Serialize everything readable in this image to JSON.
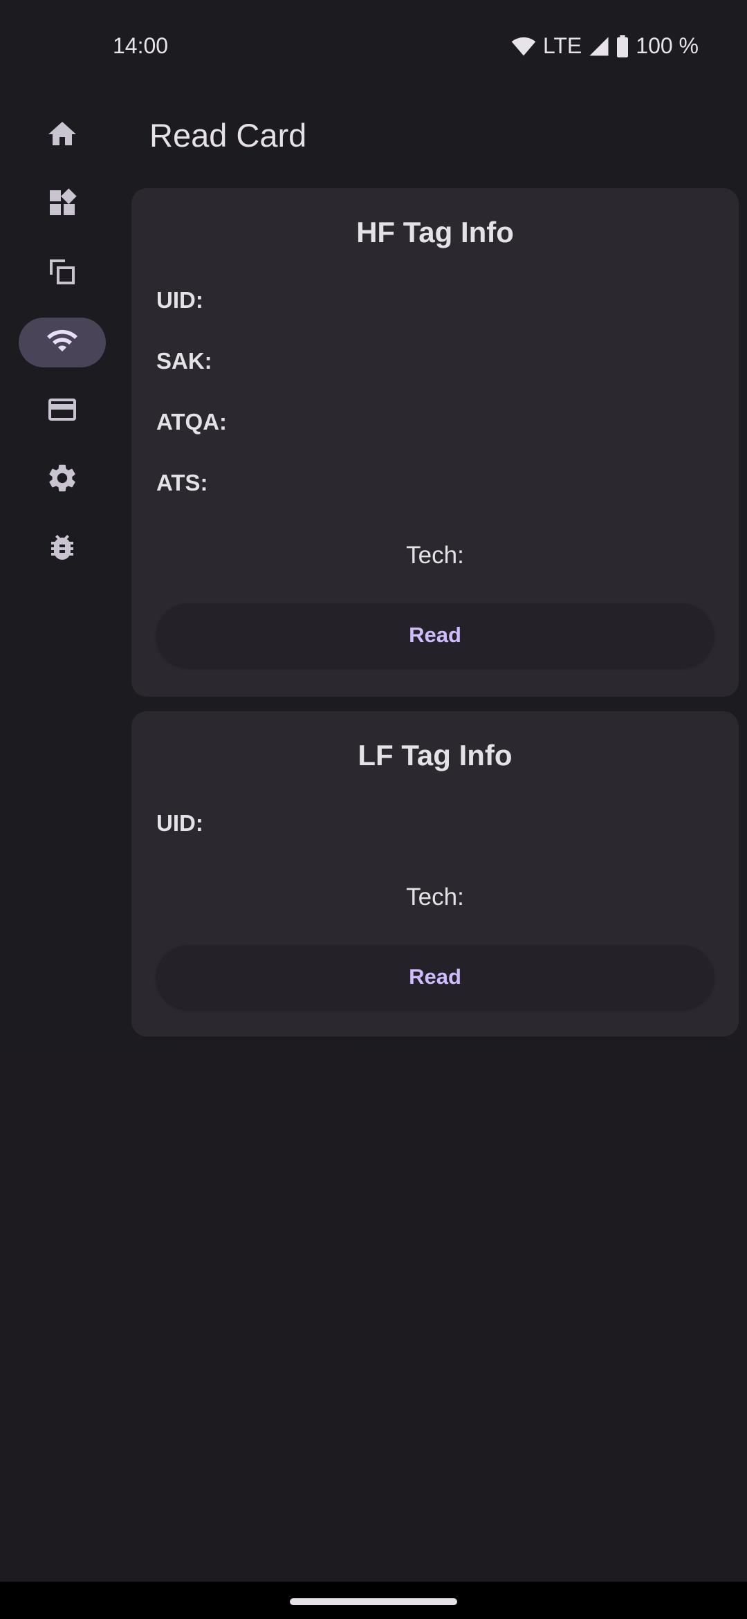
{
  "status_bar": {
    "time": "14:00",
    "network": "LTE",
    "battery": "100 %"
  },
  "nav_rail": {
    "items": [
      {
        "icon": "home-icon",
        "active": false
      },
      {
        "icon": "widgets-icon",
        "active": false
      },
      {
        "icon": "copy-icon",
        "active": false
      },
      {
        "icon": "wifi-icon",
        "active": true
      },
      {
        "icon": "card-icon",
        "active": false
      },
      {
        "icon": "gear-icon",
        "active": false
      },
      {
        "icon": "bug-icon",
        "active": false
      }
    ]
  },
  "page": {
    "title": "Read Card"
  },
  "hf_card": {
    "title": "HF Tag Info",
    "uid_label": "UID:",
    "sak_label": "SAK:",
    "atqa_label": "ATQA:",
    "ats_label": "ATS:",
    "tech_label": "Tech:",
    "read_label": "Read"
  },
  "lf_card": {
    "title": "LF Tag Info",
    "uid_label": "UID:",
    "tech_label": "Tech:",
    "read_label": "Read"
  },
  "colors": {
    "background": "#1c1b1f",
    "card": "#2b2830",
    "active_indicator": "#4a4458",
    "accent_text": "#cfbcff"
  }
}
